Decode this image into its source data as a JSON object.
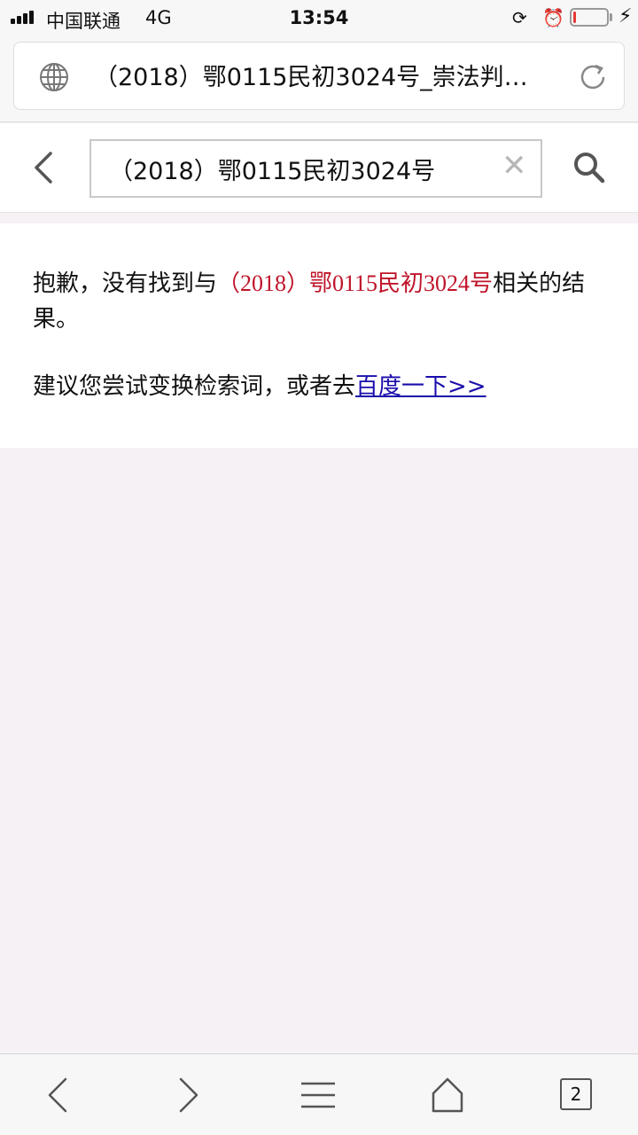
{
  "status_bar": {
    "carrier": "中国联通",
    "network": "4G",
    "time": "13:54",
    "battery_level": 0.08,
    "battery_color": "#e53935"
  },
  "address_bar": {
    "title": "（2018）鄂0115民初3024号_崇法判…",
    "icons": [
      "globe-icon",
      "reload-icon"
    ]
  },
  "search": {
    "query": "（2018）鄂0115民初3024号",
    "icons": [
      "back-icon",
      "clear-icon",
      "search-icon"
    ]
  },
  "results": {
    "message_prefix": "抱歉，没有找到与",
    "query": "（2018）鄂0115民初3024号",
    "message_suffix": "相关的结果。",
    "suggestion_prefix": "建议您尝试变换检索词，或者去",
    "suggestion_link": "百度一下>>",
    "query_color": "#c0142a",
    "link_color": "#1a0dab"
  },
  "toolbar": {
    "tab_count": "2",
    "icons": [
      "back-icon",
      "forward-icon",
      "menu-icon",
      "home-icon",
      "tabs-icon"
    ]
  }
}
